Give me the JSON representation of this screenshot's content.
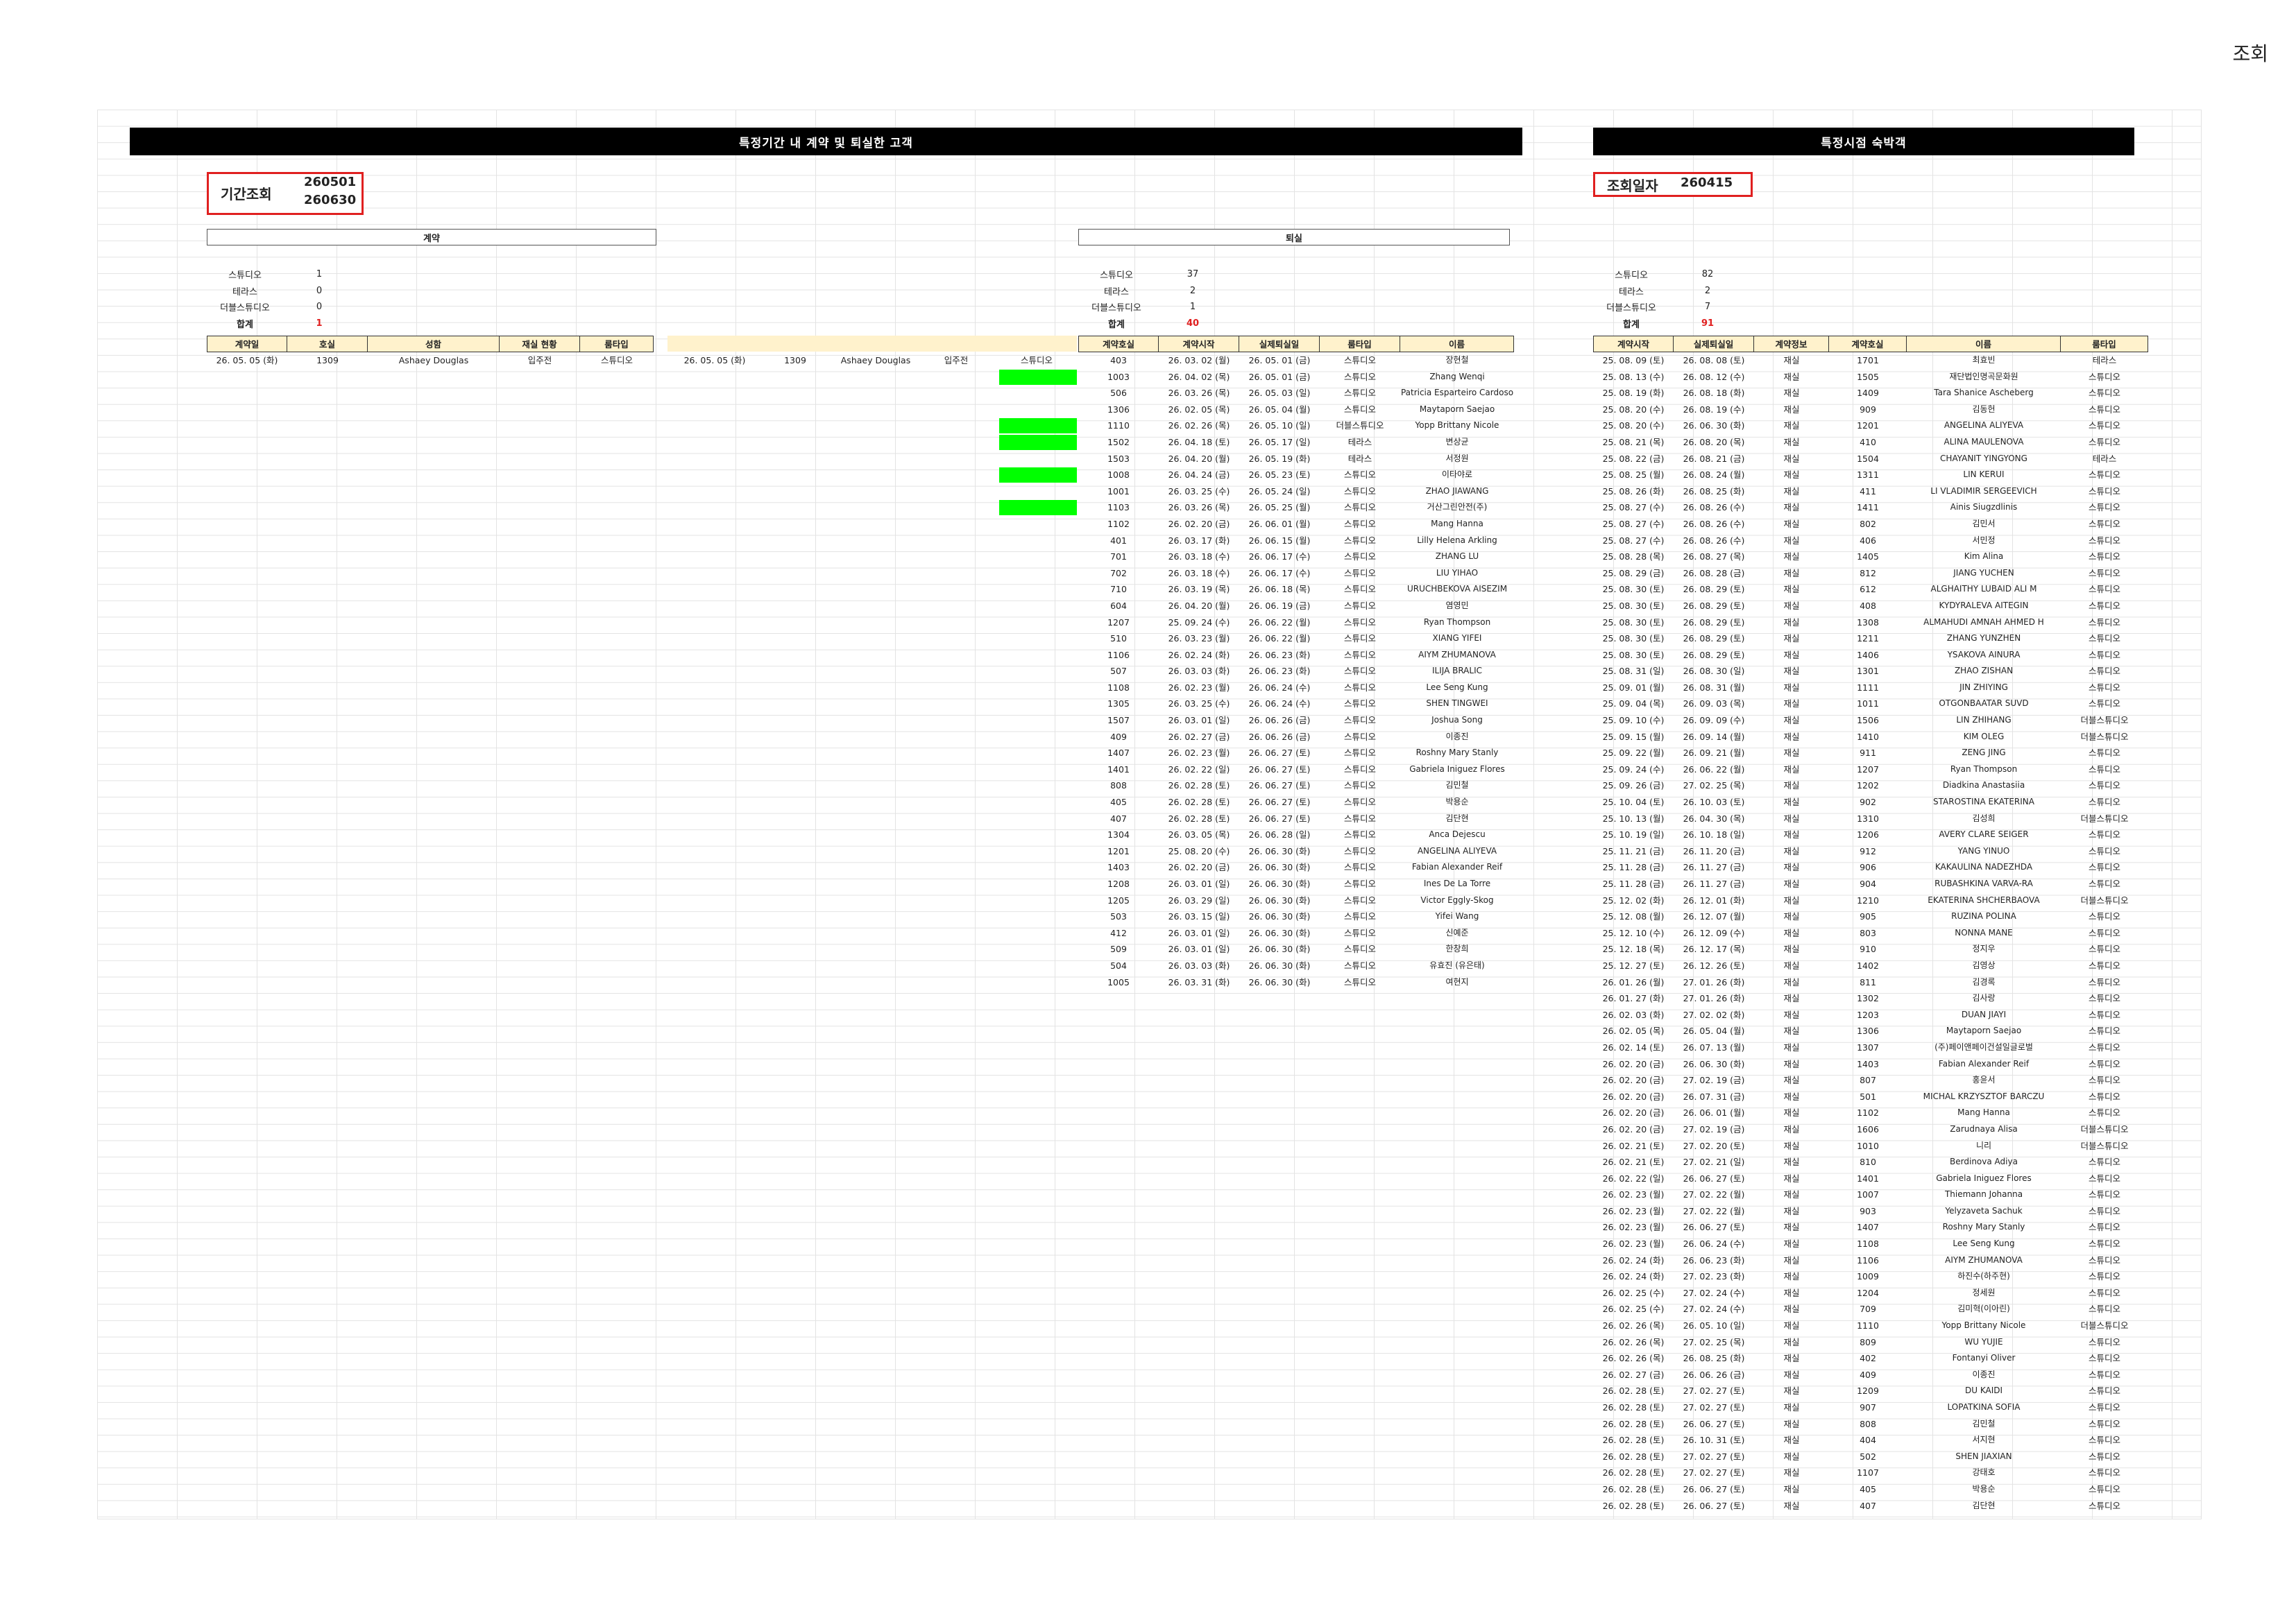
{
  "sheet_title": "조회",
  "left_banner": "특정기간 내 계약 및 퇴실한 고객",
  "right_banner": "특정시점 숙박객",
  "period": {
    "label": "기간조회",
    "start": "260501",
    "end": "260630"
  },
  "lookup": {
    "label": "조회일자",
    "value": "260415"
  },
  "contract": {
    "title": "계약",
    "summary": [
      {
        "label": "스튜디오",
        "value": "1"
      },
      {
        "label": "테라스",
        "value": "0"
      },
      {
        "label": "더블스튜디오",
        "value": "0"
      },
      {
        "label": "합계",
        "value": "1"
      }
    ],
    "headers": [
      "계약일",
      "호실",
      "성함",
      "재실 현황",
      "룸타입"
    ],
    "rows": [
      {
        "date": "26. 05. 05 (화)",
        "room": "1309",
        "name": "Ashaey Douglas",
        "status": "입주전",
        "type": "스튜디오"
      }
    ],
    "echo": {
      "date": "26. 05. 05 (화)",
      "room": "1309",
      "name": "Ashaey Douglas",
      "status": "입주전",
      "type": "스튜디오"
    }
  },
  "checkout": {
    "title": "퇴실",
    "summary": [
      {
        "label": "스튜디오",
        "value": "37"
      },
      {
        "label": "테라스",
        "value": "2"
      },
      {
        "label": "더블스튜디오",
        "value": "1"
      },
      {
        "label": "합계",
        "value": "40"
      }
    ],
    "headers": [
      "계약호실",
      "계약시작",
      "실제퇴실일",
      "룸타입",
      "이름"
    ],
    "rows": [
      [
        "403",
        "26. 03. 02 (월)",
        "26. 05. 01 (금)",
        "스튜디오",
        "장현철"
      ],
      [
        "1003",
        "26. 04. 02 (목)",
        "26. 05. 01 (금)",
        "스튜디오",
        "Zhang Wenqi"
      ],
      [
        "506",
        "26. 03. 26 (목)",
        "26. 05. 03 (일)",
        "스튜디오",
        "Patricia Esparteiro Cardoso"
      ],
      [
        "1306",
        "26. 02. 05 (목)",
        "26. 05. 04 (월)",
        "스튜디오",
        "Maytaporn Saejao"
      ],
      [
        "1110",
        "26. 02. 26 (목)",
        "26. 05. 10 (일)",
        "더블스튜디오",
        "Yopp Brittany Nicole"
      ],
      [
        "1502",
        "26. 04. 18 (토)",
        "26. 05. 17 (일)",
        "테라스",
        "변상균"
      ],
      [
        "1503",
        "26. 04. 20 (월)",
        "26. 05. 19 (화)",
        "테라스",
        "서정원"
      ],
      [
        "1008",
        "26. 04. 24 (금)",
        "26. 05. 23 (토)",
        "스튜디오",
        "이타야로"
      ],
      [
        "1001",
        "26. 03. 25 (수)",
        "26. 05. 24 (일)",
        "스튜디오",
        "ZHAO JIAWANG"
      ],
      [
        "1103",
        "26. 03. 26 (목)",
        "26. 05. 25 (월)",
        "스튜디오",
        "거산그린안전(주)"
      ],
      [
        "1102",
        "26. 02. 20 (금)",
        "26. 06. 01 (월)",
        "스튜디오",
        "Mang Hanna"
      ],
      [
        "401",
        "26. 03. 17 (화)",
        "26. 06. 15 (월)",
        "스튜디오",
        "Lilly Helena Arkling"
      ],
      [
        "701",
        "26. 03. 18 (수)",
        "26. 06. 17 (수)",
        "스튜디오",
        "ZHANG LU"
      ],
      [
        "702",
        "26. 03. 18 (수)",
        "26. 06. 17 (수)",
        "스튜디오",
        "LIU YIHAO"
      ],
      [
        "710",
        "26. 03. 19 (목)",
        "26. 06. 18 (목)",
        "스튜디오",
        "URUCHBEKOVA AISEZIM"
      ],
      [
        "604",
        "26. 04. 20 (월)",
        "26. 06. 19 (금)",
        "스튜디오",
        "염영민"
      ],
      [
        "1207",
        "25. 09. 24 (수)",
        "26. 06. 22 (월)",
        "스튜디오",
        "Ryan Thompson"
      ],
      [
        "510",
        "26. 03. 23 (월)",
        "26. 06. 22 (월)",
        "스튜디오",
        "XIANG YIFEI"
      ],
      [
        "1106",
        "26. 02. 24 (화)",
        "26. 06. 23 (화)",
        "스튜디오",
        "AIYM ZHUMANOVA"
      ],
      [
        "507",
        "26. 03. 03 (화)",
        "26. 06. 23 (화)",
        "스튜디오",
        "ILIJA BRALIC"
      ],
      [
        "1108",
        "26. 02. 23 (월)",
        "26. 06. 24 (수)",
        "스튜디오",
        "Lee Seng Kung"
      ],
      [
        "1305",
        "26. 03. 25 (수)",
        "26. 06. 24 (수)",
        "스튜디오",
        "SHEN TINGWEI"
      ],
      [
        "1507",
        "26. 03. 01 (일)",
        "26. 06. 26 (금)",
        "스튜디오",
        "Joshua Song"
      ],
      [
        "409",
        "26. 02. 27 (금)",
        "26. 06. 26 (금)",
        "스튜디오",
        "이종진"
      ],
      [
        "1407",
        "26. 02. 23 (월)",
        "26. 06. 27 (토)",
        "스튜디오",
        "Roshny Mary Stanly"
      ],
      [
        "1401",
        "26. 02. 22 (일)",
        "26. 06. 27 (토)",
        "스튜디오",
        "Gabriela Iniguez Flores"
      ],
      [
        "808",
        "26. 02. 28 (토)",
        "26. 06. 27 (토)",
        "스튜디오",
        "김민철"
      ],
      [
        "405",
        "26. 02. 28 (토)",
        "26. 06. 27 (토)",
        "스튜디오",
        "박용순"
      ],
      [
        "407",
        "26. 02. 28 (토)",
        "26. 06. 27 (토)",
        "스튜디오",
        "김단현"
      ],
      [
        "1304",
        "26. 03. 05 (목)",
        "26. 06. 28 (일)",
        "스튜디오",
        "Anca Dejescu"
      ],
      [
        "1201",
        "25. 08. 20 (수)",
        "26. 06. 30 (화)",
        "스튜디오",
        "ANGELINA ALIYEVA"
      ],
      [
        "1403",
        "26. 02. 20 (금)",
        "26. 06. 30 (화)",
        "스튜디오",
        "Fabian Alexander Reif"
      ],
      [
        "1208",
        "26. 03. 01 (일)",
        "26. 06. 30 (화)",
        "스튜디오",
        "Ines De La Torre"
      ],
      [
        "1205",
        "26. 03. 29 (일)",
        "26. 06. 30 (화)",
        "스튜디오",
        "Victor Eggly-Skog"
      ],
      [
        "503",
        "26. 03. 15 (일)",
        "26. 06. 30 (화)",
        "스튜디오",
        "Yifei Wang"
      ],
      [
        "412",
        "26. 03. 01 (일)",
        "26. 06. 30 (화)",
        "스튜디오",
        "신예준"
      ],
      [
        "509",
        "26. 03. 01 (일)",
        "26. 06. 30 (화)",
        "스튜디오",
        "한창희"
      ],
      [
        "504",
        "26. 03. 03 (화)",
        "26. 06. 30 (화)",
        "스튜디오",
        "유효진 (유은태)"
      ],
      [
        "1005",
        "26. 03. 31 (화)",
        "26. 06. 30 (화)",
        "스튜디오",
        "여현지"
      ]
    ]
  },
  "stay": {
    "summary": [
      {
        "label": "스튜디오",
        "value": "82"
      },
      {
        "label": "테라스",
        "value": "2"
      },
      {
        "label": "더블스튜디오",
        "value": "7"
      },
      {
        "label": "합계",
        "value": "91"
      }
    ],
    "headers": [
      "계약시작",
      "실제퇴실일",
      "계약정보",
      "계약호실",
      "이름",
      "룸타입"
    ],
    "rows": [
      [
        "25. 08. 09 (토)",
        "26. 08. 08 (토)",
        "재실",
        "1701",
        "최효빈",
        "테라스"
      ],
      [
        "25. 08. 13 (수)",
        "26. 08. 12 (수)",
        "재실",
        "1505",
        "재단법인명곡문화원",
        "스튜디오"
      ],
      [
        "25. 08. 19 (화)",
        "26. 08. 18 (화)",
        "재실",
        "1409",
        "Tara Shanice Ascheberg",
        "스튜디오"
      ],
      [
        "25. 08. 20 (수)",
        "26. 08. 19 (수)",
        "재실",
        "909",
        "김동헌",
        "스튜디오"
      ],
      [
        "25. 08. 20 (수)",
        "26. 06. 30 (화)",
        "재실",
        "1201",
        "ANGELINA ALIYEVA",
        "스튜디오"
      ],
      [
        "25. 08. 21 (목)",
        "26. 08. 20 (목)",
        "재실",
        "410",
        "ALINA MAULENOVA",
        "스튜디오"
      ],
      [
        "25. 08. 22 (금)",
        "26. 08. 21 (금)",
        "재실",
        "1504",
        "CHAYANIT YINGYONG",
        "테라스"
      ],
      [
        "25. 08. 25 (월)",
        "26. 08. 24 (월)",
        "재실",
        "1311",
        "LIN KERUI",
        "스튜디오"
      ],
      [
        "25. 08. 26 (화)",
        "26. 08. 25 (화)",
        "재실",
        "411",
        "LI VLADIMIR SERGEEVICH",
        "스튜디오"
      ],
      [
        "25. 08. 27 (수)",
        "26. 08. 26 (수)",
        "재실",
        "1411",
        "Ainis Siugzdlinis",
        "스튜디오"
      ],
      [
        "25. 08. 27 (수)",
        "26. 08. 26 (수)",
        "재실",
        "802",
        "김민서",
        "스튜디오"
      ],
      [
        "25. 08. 27 (수)",
        "26. 08. 26 (수)",
        "재실",
        "406",
        "서민정",
        "스튜디오"
      ],
      [
        "25. 08. 28 (목)",
        "26. 08. 27 (목)",
        "재실",
        "1405",
        "Kim Alina",
        "스튜디오"
      ],
      [
        "25. 08. 29 (금)",
        "26. 08. 28 (금)",
        "재실",
        "812",
        "JIANG YUCHEN",
        "스튜디오"
      ],
      [
        "25. 08. 30 (토)",
        "26. 08. 29 (토)",
        "재실",
        "612",
        "ALGHAITHY LUBAID ALI M",
        "스튜디오"
      ],
      [
        "25. 08. 30 (토)",
        "26. 08. 29 (토)",
        "재실",
        "408",
        "KYDYRALEVA AITEGIN",
        "스튜디오"
      ],
      [
        "25. 08. 30 (토)",
        "26. 08. 29 (토)",
        "재실",
        "1308",
        "ALMAHUDI AMNAH AHMED H",
        "스튜디오"
      ],
      [
        "25. 08. 30 (토)",
        "26. 08. 29 (토)",
        "재실",
        "1211",
        "ZHANG YUNZHEN",
        "스튜디오"
      ],
      [
        "25. 08. 30 (토)",
        "26. 08. 29 (토)",
        "재실",
        "1406",
        "YSAKOVA AINURA",
        "스튜디오"
      ],
      [
        "25. 08. 31 (일)",
        "26. 08. 30 (일)",
        "재실",
        "1301",
        "ZHAO ZISHAN",
        "스튜디오"
      ],
      [
        "25. 09. 01 (월)",
        "26. 08. 31 (월)",
        "재실",
        "1111",
        "JIN ZHIYING",
        "스튜디오"
      ],
      [
        "25. 09. 04 (목)",
        "26. 09. 03 (목)",
        "재실",
        "1011",
        "OTGONBAATAR SUVD",
        "스튜디오"
      ],
      [
        "25. 09. 10 (수)",
        "26. 09. 09 (수)",
        "재실",
        "1506",
        "LIN ZHIHANG",
        "더블스튜디오"
      ],
      [
        "25. 09. 15 (월)",
        "26. 09. 14 (월)",
        "재실",
        "1410",
        "KIM OLEG",
        "더블스튜디오"
      ],
      [
        "25. 09. 22 (월)",
        "26. 09. 21 (월)",
        "재실",
        "911",
        "ZENG JING",
        "스튜디오"
      ],
      [
        "25. 09. 24 (수)",
        "26. 06. 22 (월)",
        "재실",
        "1207",
        "Ryan Thompson",
        "스튜디오"
      ],
      [
        "25. 09. 26 (금)",
        "27. 02. 25 (목)",
        "재실",
        "1202",
        "Diadkina Anastasiia",
        "스튜디오"
      ],
      [
        "25. 10. 04 (토)",
        "26. 10. 03 (토)",
        "재실",
        "902",
        "STAROSTINA EKATERINA",
        "스튜디오"
      ],
      [
        "25. 10. 13 (월)",
        "26. 04. 30 (목)",
        "재실",
        "1310",
        "김성희",
        "더블스튜디오"
      ],
      [
        "25. 10. 19 (일)",
        "26. 10. 18 (일)",
        "재실",
        "1206",
        "AVERY CLARE SEIGER",
        "스튜디오"
      ],
      [
        "25. 11. 21 (금)",
        "26. 11. 20 (금)",
        "재실",
        "912",
        "YANG YINUO",
        "스튜디오"
      ],
      [
        "25. 11. 28 (금)",
        "26. 11. 27 (금)",
        "재실",
        "906",
        "KAKAULINA NADEZHDA",
        "스튜디오"
      ],
      [
        "25. 11. 28 (금)",
        "26. 11. 27 (금)",
        "재실",
        "904",
        "RUBASHKINA VARVA-RA",
        "스튜디오"
      ],
      [
        "25. 12. 02 (화)",
        "26. 12. 01 (화)",
        "재실",
        "1210",
        "EKATERINA SHCHERBAOVA",
        "더블스튜디오"
      ],
      [
        "25. 12. 08 (월)",
        "26. 12. 07 (월)",
        "재실",
        "905",
        "RUZINA POLINA",
        "스튜디오"
      ],
      [
        "25. 12. 10 (수)",
        "26. 12. 09 (수)",
        "재실",
        "803",
        "NONNA MANE",
        "스튜디오"
      ],
      [
        "25. 12. 18 (목)",
        "26. 12. 17 (목)",
        "재실",
        "910",
        "정지우",
        "스튜디오"
      ],
      [
        "25. 12. 27 (토)",
        "26. 12. 26 (토)",
        "재실",
        "1402",
        "김영상",
        "스튜디오"
      ],
      [
        "26. 01. 26 (월)",
        "27. 01. 26 (화)",
        "재실",
        "811",
        "김경록",
        "스튜디오"
      ],
      [
        "26. 01. 27 (화)",
        "27. 01. 26 (화)",
        "재실",
        "1302",
        "김사랑",
        "스튜디오"
      ],
      [
        "26. 02. 03 (화)",
        "27. 02. 02 (화)",
        "재실",
        "1203",
        "DUAN JIAYI",
        "스튜디오"
      ],
      [
        "26. 02. 05 (목)",
        "26. 05. 04 (월)",
        "재실",
        "1306",
        "Maytaporn Saejao",
        "스튜디오"
      ],
      [
        "26. 02. 14 (토)",
        "26. 07. 13 (월)",
        "재실",
        "1307",
        "(주)페이앤페이건설일글로벌",
        "스튜디오"
      ],
      [
        "26. 02. 20 (금)",
        "26. 06. 30 (화)",
        "재실",
        "1403",
        "Fabian Alexander Reif",
        "스튜디오"
      ],
      [
        "26. 02. 20 (금)",
        "27. 02. 19 (금)",
        "재실",
        "807",
        "홍윤서",
        "스튜디오"
      ],
      [
        "26. 02. 20 (금)",
        "26. 07. 31 (금)",
        "재실",
        "501",
        "MICHAL KRZYSZTOF BARCZU",
        "스튜디오"
      ],
      [
        "26. 02. 20 (금)",
        "26. 06. 01 (월)",
        "재실",
        "1102",
        "Mang Hanna",
        "스튜디오"
      ],
      [
        "26. 02. 20 (금)",
        "27. 02. 19 (금)",
        "재실",
        "1606",
        "Zarudnaya Alisa",
        "더블스튜디오"
      ],
      [
        "26. 02. 21 (토)",
        "27. 02. 20 (토)",
        "재실",
        "1010",
        "니리",
        "더블스튜디오"
      ],
      [
        "26. 02. 21 (토)",
        "27. 02. 21 (일)",
        "재실",
        "810",
        "Berdinova Adiya",
        "스튜디오"
      ],
      [
        "26. 02. 22 (일)",
        "26. 06. 27 (토)",
        "재실",
        "1401",
        "Gabriela Iniguez Flores",
        "스튜디오"
      ],
      [
        "26. 02. 23 (월)",
        "27. 02. 22 (월)",
        "재실",
        "1007",
        "Thiemann Johanna",
        "스튜디오"
      ],
      [
        "26. 02. 23 (월)",
        "27. 02. 22 (월)",
        "재실",
        "903",
        "Yelyzaveta Sachuk",
        "스튜디오"
      ],
      [
        "26. 02. 23 (월)",
        "26. 06. 27 (토)",
        "재실",
        "1407",
        "Roshny Mary Stanly",
        "스튜디오"
      ],
      [
        "26. 02. 23 (월)",
        "26. 06. 24 (수)",
        "재실",
        "1108",
        "Lee Seng Kung",
        "스튜디오"
      ],
      [
        "26. 02. 24 (화)",
        "26. 06. 23 (화)",
        "재실",
        "1106",
        "AIYM ZHUMANOVA",
        "스튜디오"
      ],
      [
        "26. 02. 24 (화)",
        "27. 02. 23 (화)",
        "재실",
        "1009",
        "하진수(하주현)",
        "스튜디오"
      ],
      [
        "26. 02. 25 (수)",
        "27. 02. 24 (수)",
        "재실",
        "1204",
        "정세원",
        "스튜디오"
      ],
      [
        "26. 02. 25 (수)",
        "27. 02. 24 (수)",
        "재실",
        "709",
        "김미혁(이아린)",
        "스튜디오"
      ],
      [
        "26. 02. 26 (목)",
        "26. 05. 10 (일)",
        "재실",
        "1110",
        "Yopp Brittany Nicole",
        "더블스튜디오"
      ],
      [
        "26. 02. 26 (목)",
        "27. 02. 25 (목)",
        "재실",
        "809",
        "WU YUJIE",
        "스튜디오"
      ],
      [
        "26. 02. 26 (목)",
        "26. 08. 25 (화)",
        "재실",
        "402",
        "Fontanyi Oliver",
        "스튜디오"
      ],
      [
        "26. 02. 27 (금)",
        "26. 06. 26 (금)",
        "재실",
        "409",
        "이종진",
        "스튜디오"
      ],
      [
        "26. 02. 28 (토)",
        "27. 02. 27 (토)",
        "재실",
        "1209",
        "DU KAIDI",
        "스튜디오"
      ],
      [
        "26. 02. 28 (토)",
        "27. 02. 27 (토)",
        "재실",
        "907",
        "LOPATKINA SOFIA",
        "스튜디오"
      ],
      [
        "26. 02. 28 (토)",
        "26. 06. 27 (토)",
        "재실",
        "808",
        "김민철",
        "스튜디오"
      ],
      [
        "26. 02. 28 (토)",
        "26. 10. 31 (토)",
        "재실",
        "404",
        "서지현",
        "스튜디오"
      ],
      [
        "26. 02. 28 (토)",
        "27. 02. 27 (토)",
        "재실",
        "502",
        "SHEN JIAXIAN",
        "스튜디오"
      ],
      [
        "26. 02. 28 (토)",
        "27. 02. 27 (토)",
        "재실",
        "1107",
        "강태호",
        "스튜디오"
      ],
      [
        "26. 02. 28 (토)",
        "26. 06. 27 (토)",
        "재실",
        "405",
        "박용순",
        "스튜디오"
      ],
      [
        "26. 02. 28 (토)",
        "26. 06. 27 (토)",
        "재실",
        "407",
        "김단현",
        "스튜디오"
      ]
    ]
  },
  "green_marks": [
    1,
    4,
    5,
    7,
    9
  ]
}
